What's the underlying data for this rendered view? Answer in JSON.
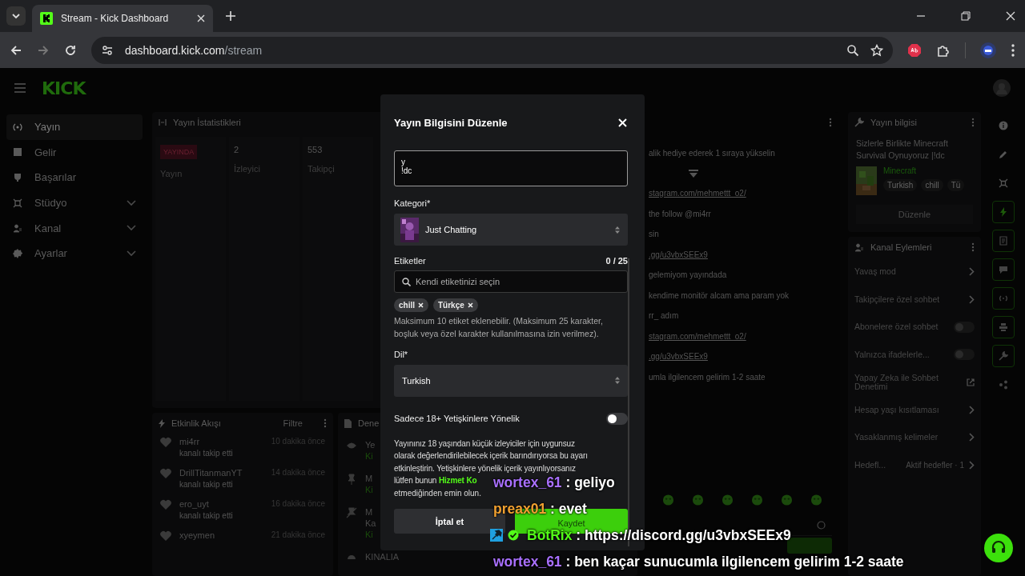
{
  "browser": {
    "tab_title": "Stream - Kick Dashboard",
    "url_host": "dashboard.kick.com",
    "url_path": "/stream"
  },
  "header": {
    "logo": "KICK"
  },
  "sidebar": {
    "items": [
      {
        "label": "Yayın",
        "selected": true,
        "expandable": false
      },
      {
        "label": "Gelir",
        "selected": false,
        "expandable": false
      },
      {
        "label": "Başarılar",
        "selected": false,
        "expandable": false
      },
      {
        "label": "Stüdyo",
        "selected": false,
        "expandable": true
      },
      {
        "label": "Kanal",
        "selected": false,
        "expandable": true
      },
      {
        "label": "Ayarlar",
        "selected": false,
        "expandable": true
      }
    ]
  },
  "stats": {
    "title": "Yayın İstatistikleri",
    "cells": [
      {
        "kind": "badge",
        "value": "YAYINDA",
        "label": "Yayın"
      },
      {
        "kind": "number",
        "value": "2",
        "label": "İzleyici"
      },
      {
        "kind": "number",
        "value": "553",
        "label": "Takipçi"
      }
    ]
  },
  "activity": {
    "title": "Etkinlik Akışı",
    "filter": "Filtre",
    "items": [
      {
        "name": "mi4rr",
        "action": "kanalı takip etti",
        "time": "10 dakika önce"
      },
      {
        "name": "DrillTitanmanYT",
        "action": "kanalı takip etti",
        "time": "14 dakika önce"
      },
      {
        "name": "ero_uyt",
        "action": "kanalı takip etti",
        "time": "16 dakika önce"
      },
      {
        "name": "xyeymen",
        "time": "21 dakika önce"
      }
    ]
  },
  "events": {
    "title": "Dene",
    "items": [
      {
        "lines": [
          "Ye",
          "Ki"
        ]
      },
      {
        "lines": [
          "M",
          "Ki"
        ]
      },
      {
        "lines": [
          "M",
          "Ka",
          "Ki"
        ]
      },
      {
        "lines": [
          "KINALIA"
        ]
      }
    ]
  },
  "chat": {
    "messages": [
      {
        "text": "alik hediye ederek 1 sıraya yükselin",
        "link": false
      },
      {
        "text": "stagram.com/mehmettt_o2/",
        "link": true
      },
      {
        "text": "the follow @mi4rr",
        "link": false
      },
      {
        "text": "sin",
        "link": false
      },
      {
        "text": ".gg/u3vbxSEEx9",
        "link": true
      },
      {
        "text": "gelemiyom yayındada",
        "link": false
      },
      {
        "text": "kendime monitör alcam ama param yok",
        "link": false
      },
      {
        "text": "rr_ adım",
        "link": false
      },
      {
        "text": "stagram.com/mehmettt_o2/",
        "link": true
      },
      {
        "text": ".gg/u3vbxSEEx9",
        "link": true
      },
      {
        "text": "umla ilgilencem gelirim 1-2 saate",
        "link": false
      }
    ]
  },
  "stream_info": {
    "title": "Yayın bilgisi",
    "stream_title": "Sizlerle Birlikte Minecraft Survival Oynuyoruz |!dc",
    "category": "Minecraft",
    "tags": [
      "Turkish",
      "chill",
      "Tü"
    ],
    "edit_button": "Düzenle"
  },
  "channel_actions": {
    "title": "Kanal Eylemleri",
    "items": [
      {
        "kind": "chevron",
        "label": "Yavaş mod"
      },
      {
        "kind": "chevron",
        "label": "Takipçilere özel sohbet"
      },
      {
        "kind": "toggle",
        "label": "Abonelere özel sohbet",
        "on": false
      },
      {
        "kind": "toggle",
        "label": "Yalnızca ifadelerle...",
        "on": false
      },
      {
        "kind": "external",
        "label": "Yapay Zeka ile Sohbet Denetimi"
      },
      {
        "kind": "chevron",
        "label": "Hesap yaşı kısıtlaması"
      },
      {
        "kind": "chevron",
        "label": "Yasaklanmış kelimeler"
      },
      {
        "kind": "goal",
        "label": "Hedefl...",
        "status": "Aktif hedefler · 1"
      }
    ]
  },
  "rail": [
    {
      "active": false
    },
    {
      "active": false
    },
    {
      "active": false
    },
    {
      "active": true
    },
    {
      "active": true
    },
    {
      "active": true
    },
    {
      "active": true
    },
    {
      "active": true
    },
    {
      "active": true
    },
    {
      "active": false
    }
  ],
  "modal": {
    "title": "Yayın Bilgisini Düzenle",
    "title_value": "y\n!dc",
    "category_label": "Kategori*",
    "category": "Just Chatting",
    "tags_label": "Etiketler",
    "tags_count": "0 / 25",
    "tags_placeholder": "Kendi etiketinizi seçin",
    "tags": [
      "chill",
      "Türkçe"
    ],
    "tags_help": "Maksimum 10 etiket eklenebilir. (Maksimum 25 karakter, boşluk veya özel karakter kullanılmasına izin verilmez).",
    "language_label": "Dil*",
    "language": "Turkish",
    "mature_label": "Sadece 18+ Yetişkinlere Yönelik",
    "mature_on": false,
    "mature_text": "Yayınınız 18 yaşından küçük izleyiciler için uygunsuz olarak değerlendirilebilecek içerik barındırıyorsa bu ayarı etkinleştirin. Yetişkinlere yönelik içerik yayınlıyorsanız lütfen bunun",
    "mature_link": "Hizmet Ko",
    "mature_tail": "etmediğinden emin olun.",
    "cancel": "İptal et",
    "save": "Kaydet"
  },
  "overlay_chat": [
    {
      "kind": "user",
      "name": "wortex_61",
      "color": "#a970ff",
      "message": ": geliyo"
    },
    {
      "kind": "user",
      "name": "preax01",
      "color": "#f0a030",
      "message": ": evet"
    },
    {
      "kind": "bot",
      "name": "BotRix",
      "color": "#53fc18",
      "message": ": https://discord.gg/u3vbxSEEx9"
    },
    {
      "kind": "user",
      "name": "wortex_61",
      "color": "#a970ff",
      "message": ": ben kaçar sunucumla ilgilencem gelirim 1-2 saate"
    }
  ]
}
